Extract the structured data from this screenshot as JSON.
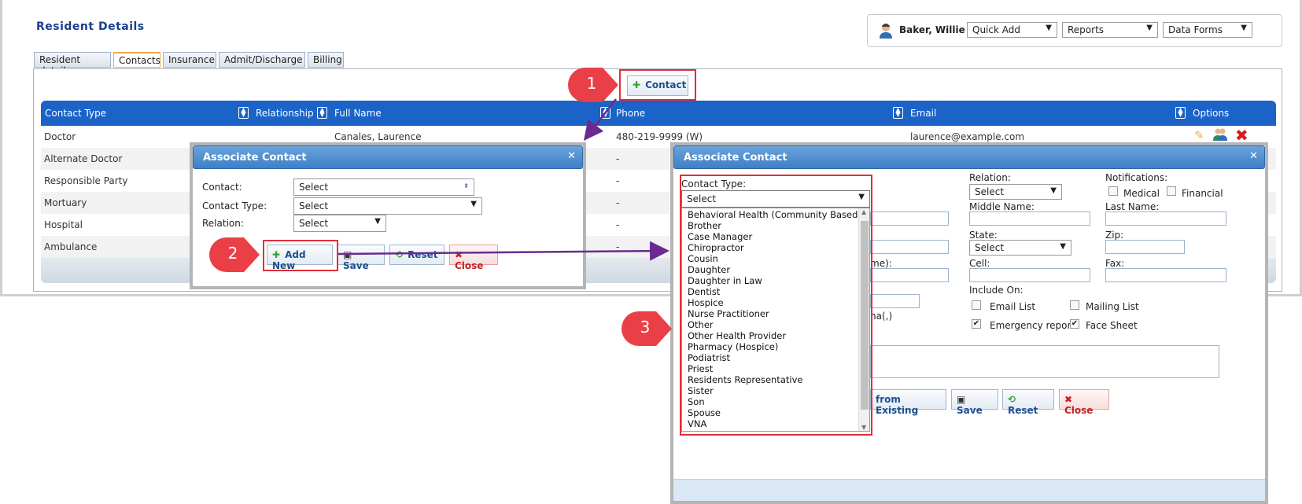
{
  "page": {
    "title": "Resident Details"
  },
  "userbar": {
    "name": "Baker, Willie",
    "quick_add": "Quick Add",
    "reports": "Reports",
    "data_forms": "Data Forms"
  },
  "tabs": [
    "Resident details",
    "Contacts",
    "Insurance",
    "Admit/Discharge",
    "Billing"
  ],
  "contact_button": "Contact",
  "grid": {
    "headers": [
      "Contact Type",
      "Relationship",
      "Full Name",
      "Phone",
      "Email",
      "Options"
    ],
    "rows": [
      {
        "type": "Doctor",
        "name": "Canales, Laurence",
        "phone": "480-219-9999 (W)",
        "email": "laurence@example.com"
      },
      {
        "type": "Alternate Doctor",
        "phone": "-"
      },
      {
        "type": "Responsible Party",
        "phone": "-"
      },
      {
        "type": "Mortuary",
        "phone": "-"
      },
      {
        "type": "Hospital",
        "phone": "-"
      },
      {
        "type": "Ambulance",
        "phone": "-"
      }
    ]
  },
  "dialog_small": {
    "title": "Associate Contact",
    "contact_label": "Contact:",
    "contact_value": "Select",
    "ctype_label": "Contact Type:",
    "ctype_value": "Select",
    "relation_label": "Relation:",
    "relation_value": "Select",
    "add_new": "Add New",
    "save": "Save",
    "reset": "Reset",
    "close": "Close"
  },
  "dialog_big": {
    "title": "Associate Contact",
    "ctype_label": "Contact Type:",
    "ctype_value": "Select",
    "options": [
      "Behavioral Health (Community Based)",
      "Brother",
      "Case Manager",
      "Chiropractor",
      "Cousin",
      "Daughter",
      "Daughter in Law",
      "Dentist",
      "Hospice",
      "Nurse Practitioner",
      "Other",
      "Other Health Provider",
      "Pharmacy (Hospice)",
      "Podiatrist",
      "Priest",
      "Residents Representative",
      "Sister",
      "Son",
      "Spouse",
      "VNA"
    ],
    "relation_label": "Relation:",
    "relation_value": "Select",
    "notifications_label": "Notifications:",
    "medical": "Medical",
    "financial": "Financial",
    "middle_name": "Middle Name:",
    "last_name": "Last Name:",
    "state": "State:",
    "state_value": "Select",
    "zip": "Zip:",
    "cell": "Cell:",
    "fax": "Fax:",
    "partial_colon": ":",
    "partial_me": "me):",
    "partial_ma": "na(,)",
    "include_on": "Include On:",
    "email_list": "Email List",
    "mailing_list": "Mailing List",
    "emergency_report": "Emergency report",
    "face_sheet": "Face Sheet",
    "from_existing": "from Existing",
    "save": "Save",
    "reset": "Reset",
    "close": "Close"
  },
  "markers": [
    "1",
    "2",
    "3"
  ],
  "colors": {
    "grid_header": "#1b63c6",
    "highlight": "#e32d3a",
    "arrow": "#6b2a8f"
  }
}
